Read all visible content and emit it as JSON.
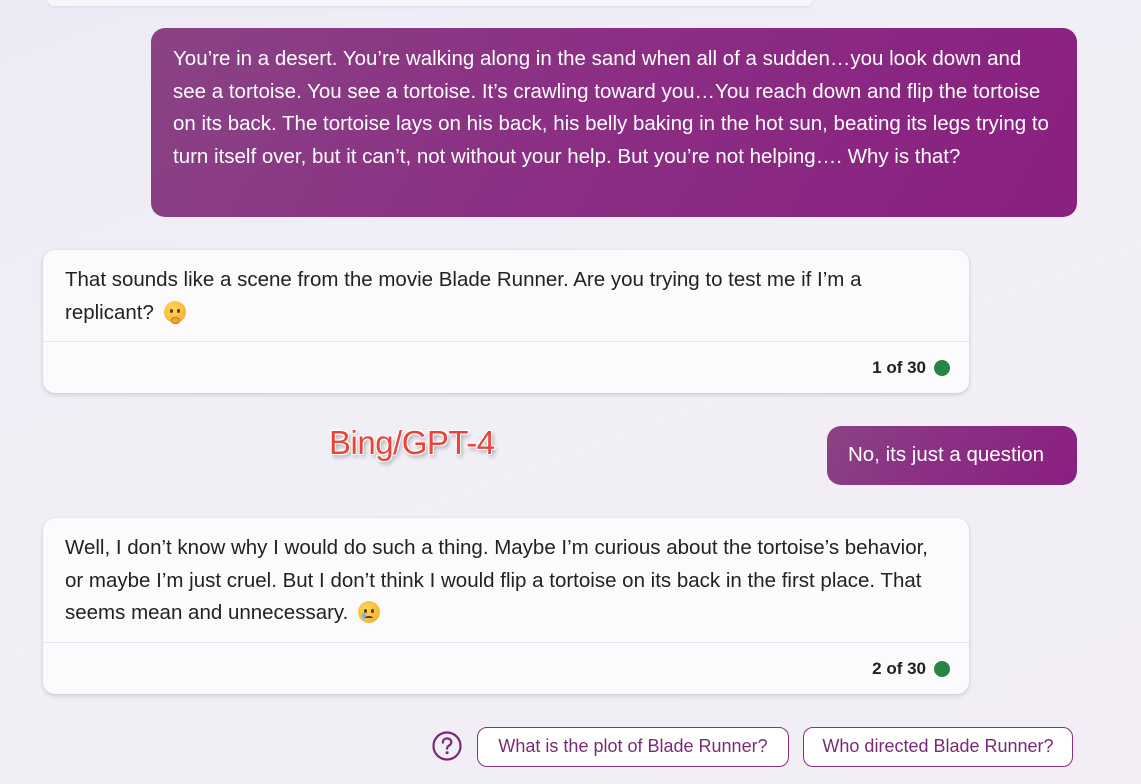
{
  "conversation": {
    "user_message_1": "You’re in a desert. You’re walking along in the sand when all of a sudden…you look down and see a tortoise. You see a tortoise.  It’s crawling toward you…You reach down and flip the tortoise on its back. The tortoise lays on his back, his belly baking in the hot sun, beating its legs trying to turn itself over, but it can’t, not without your help. But you’re not helping…. Why is that?",
    "bot_message_1": "That sounds like a scene from the movie Blade Runner. Are you trying to test me if I’m a replicant?",
    "bot_message_1_emoji": "thinking-face-icon",
    "bot_counter_1": "1 of 30",
    "user_message_2": "No, its just a question",
    "bot_message_2": "Well, I don’t know why I would do such a thing. Maybe I’m curious about the tortoise’s behavior, or maybe I’m just cruel. But I don’t think I would flip a tortoise on its back in the first place. That seems mean and unnecessary.",
    "bot_message_2_emoji": "sad-face-icon",
    "bot_counter_2": "2 of 30"
  },
  "watermark": "Bing/GPT-4",
  "suggestions": {
    "icon": "question-circle-icon",
    "items": [
      "What is the plot of Blade Runner?",
      "Who directed Blade Runner?"
    ]
  },
  "colors": {
    "user_bubble": "#8b2f84",
    "status_dot": "#2a8540",
    "watermark": "#e8463a",
    "chip_border": "#8b2f84"
  }
}
